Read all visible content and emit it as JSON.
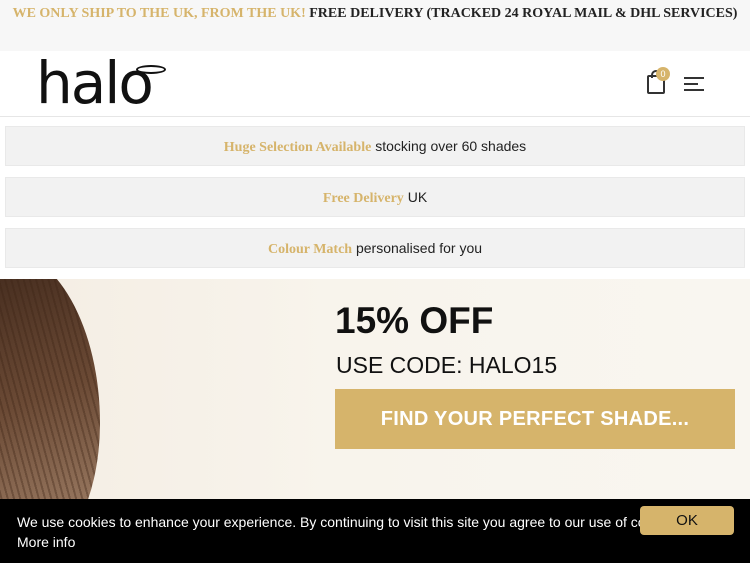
{
  "top_banner": {
    "highlight": "WE ONLY SHIP TO THE UK, FROM THE UK!",
    "text": "FREE DELIVERY (TRACKED 24 ROYAL MAIL & DHL SERVICES)"
  },
  "header": {
    "logo_text": "halo",
    "cart_count": "0"
  },
  "usps": [
    {
      "highlight": "Huge Selection Available",
      "text": "stocking over 60 shades"
    },
    {
      "highlight": "Free Delivery",
      "text": "UK"
    },
    {
      "highlight": "Colour Match",
      "text": "personalised for you"
    }
  ],
  "hero": {
    "title": "15% OFF",
    "code_line": "USE CODE: HALO15",
    "cta_label": "FIND YOUR PERFECT SHADE..."
  },
  "cookie": {
    "message": "We use cookies to enhance your experience. By continuing to visit this site you agree to our use of cookies.",
    "more_info": "More info",
    "ok_label": "OK"
  },
  "colors": {
    "accent": "#d6b46b",
    "cookie_bg": "#000000"
  },
  "icons": [
    "shopping-bag-icon",
    "menu-icon"
  ]
}
